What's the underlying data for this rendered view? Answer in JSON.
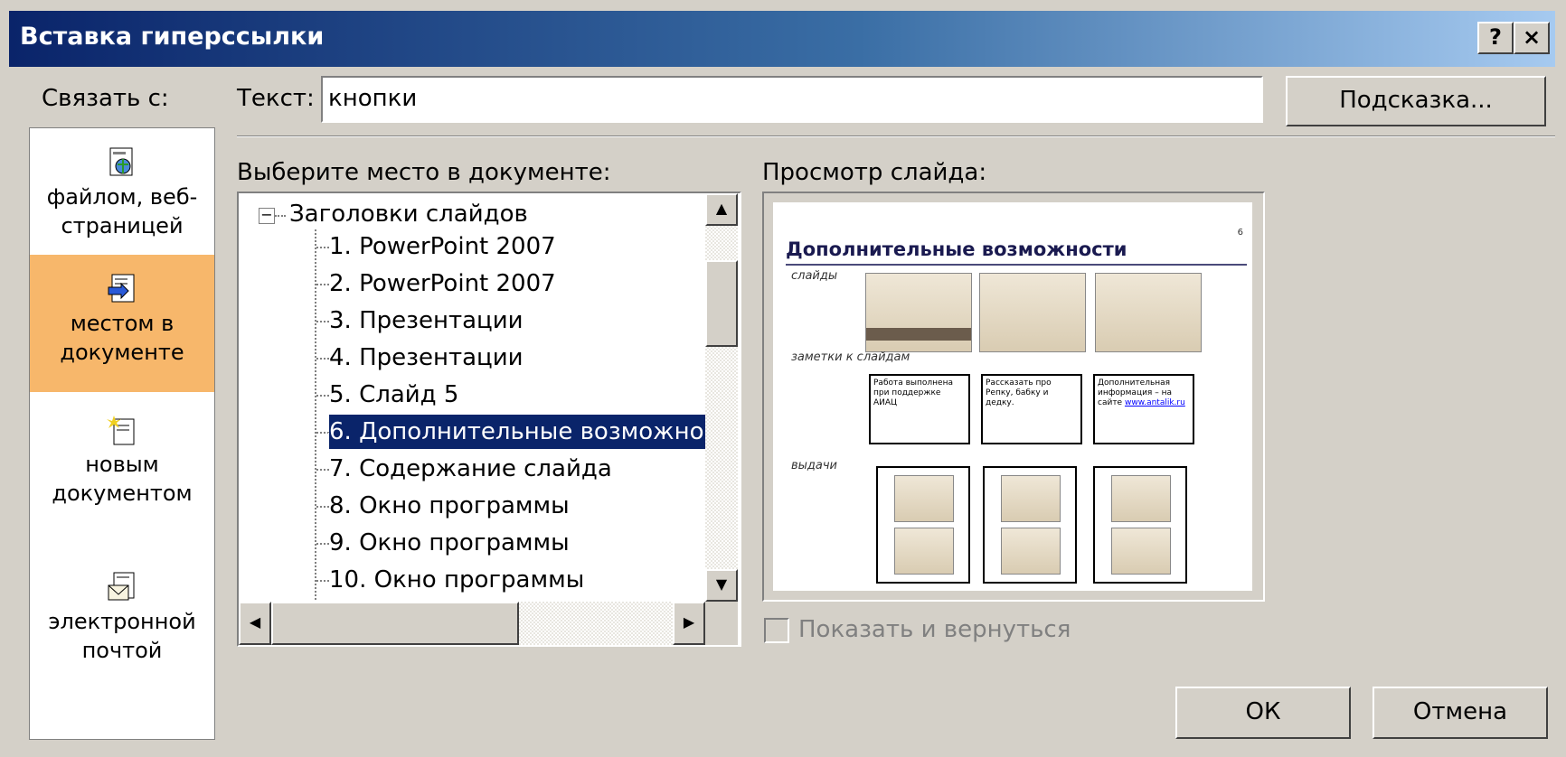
{
  "window": {
    "title": "Вставка гиперссылки",
    "help_btn": "?",
    "close_btn": "×"
  },
  "link_to": {
    "label": "Связать с:",
    "items": [
      {
        "line1": "файлом, веб-",
        "line2": "страницей",
        "icon": "web-page-icon",
        "selected": false
      },
      {
        "line1": "местом в",
        "line2": "документе",
        "icon": "place-in-document-icon",
        "selected": true
      },
      {
        "line1": "новым",
        "line2": "документом",
        "icon": "new-document-icon",
        "selected": false
      },
      {
        "line1": "электронной",
        "line2": "почтой",
        "icon": "email-icon",
        "selected": false
      }
    ]
  },
  "text_field": {
    "label": "Текст:",
    "value": "кнопки"
  },
  "hint_button": "Подсказка...",
  "place": {
    "label": "Выберите место в документе:",
    "root": "Заголовки слайдов",
    "items": [
      "1. PowerPoint 2007",
      "2. PowerPoint 2007",
      "3. Презентации",
      "4. Презентации",
      "5. Слайд 5",
      "6. Дополнительные возможнос",
      "7. Содержание слайда",
      "8. Окно программы",
      "9. Окно программы",
      "10. Окно программы"
    ],
    "selected_index": 5
  },
  "preview": {
    "label": "Просмотр слайда:",
    "slide_title": "Дополнительные возможности",
    "slide_number": "6",
    "row_labels": [
      "слайды",
      "заметки к слайдам",
      "выдачи"
    ],
    "notes": [
      "Работа выполнена при поддержке АИАЦ",
      "Рассказать про Репку, бабку и дедку.",
      "Дополнительная информация – на сайте"
    ],
    "note_link": "www.antalik.ru"
  },
  "show_and_return": "Показать и вернуться",
  "ok_button": "ОК",
  "cancel_button": "Отмена",
  "colors": {
    "selection": "#0a246a",
    "link_bar_selected": "#f7b76b",
    "dialog_bg": "#d4d0c8"
  }
}
